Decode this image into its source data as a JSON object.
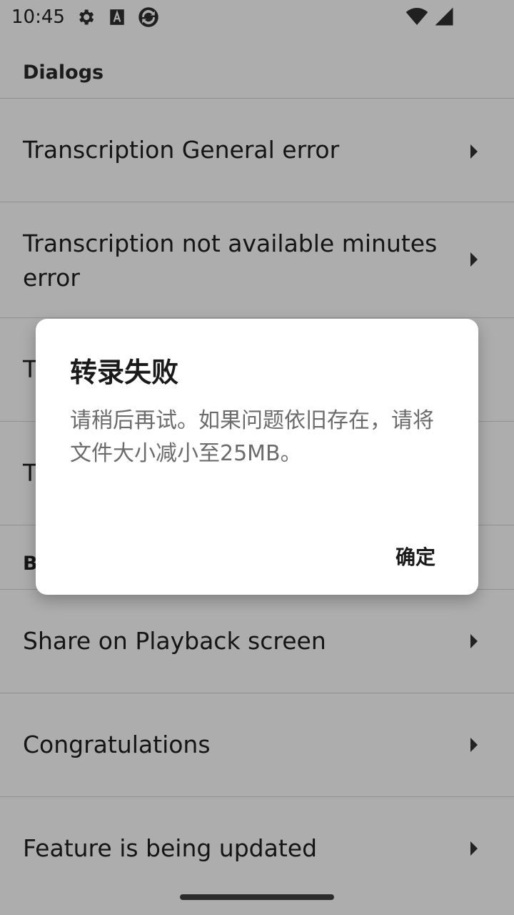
{
  "status_bar": {
    "time": "10:45",
    "icons": [
      "gear-icon",
      "font-a-icon",
      "sync-circle-icon",
      "wifi-icon",
      "cellular-signal-icon"
    ]
  },
  "section": {
    "dialogs_header": "Dialogs"
  },
  "list": {
    "items": [
      {
        "label": "Transcription General error"
      },
      {
        "label": "Transcription not available minutes error"
      },
      {
        "label": "T"
      },
      {
        "label": "T"
      },
      {
        "label": "B"
      },
      {
        "label": "Share on Playback screen"
      },
      {
        "label": "Congratulations"
      },
      {
        "label": "Feature is being updated"
      }
    ]
  },
  "dialog": {
    "title": "转录失败",
    "message": "请稍后再试。如果问题依旧存在，请将文件大小减小至25MB。",
    "confirm_label": "确定"
  },
  "colors": {
    "scrim": "#00000052",
    "dialog_bg": "#ffffff",
    "text_primary": "#202020",
    "text_secondary": "#6b6b6b"
  }
}
